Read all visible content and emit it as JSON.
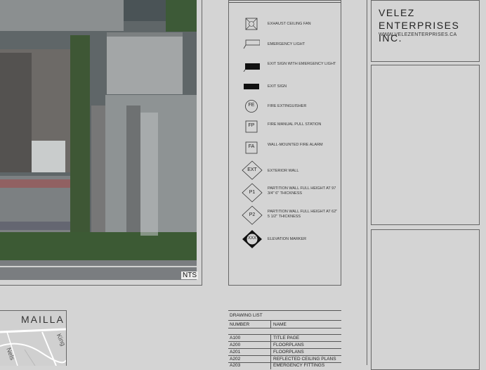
{
  "sheet": {
    "scale_note": "NTS"
  },
  "legend": {
    "items": [
      {
        "symbol": "exhaust-fan",
        "label": "EXHAUST CEILING FAN",
        "code": ""
      },
      {
        "symbol": "emergency-light",
        "label": "EMERGENCY LIGHT",
        "code": ""
      },
      {
        "symbol": "exit-emergency",
        "label": "EXIT SIGN WITH EMERGENCY LIGHT",
        "code": ""
      },
      {
        "symbol": "exit-sign",
        "label": "EXIT SIGN",
        "code": ""
      },
      {
        "symbol": "circle",
        "label": "FIRE EXTINGUISHER",
        "code": "FE"
      },
      {
        "symbol": "square",
        "label": "FIRE MANUAL PULL STATION",
        "code": "FP"
      },
      {
        "symbol": "square",
        "label": "WALL-MOUNTED FIRE ALARM",
        "code": "FA"
      },
      {
        "symbol": "diamond",
        "label": "EXTERIOR WALL",
        "code": "EXT"
      },
      {
        "symbol": "diamond",
        "label": "PARTITION WALL FULL HEIGHT AT 97 3/4\" 6\" THICKNESS",
        "code": "P1"
      },
      {
        "symbol": "diamond",
        "label": "PARTITION WALL FULL HEIGHT AT 62\" 5 1/2\" THICKNESS",
        "code": "P2"
      },
      {
        "symbol": "elevation",
        "label": "ELEVATION MARKER",
        "code": "XXX"
      }
    ]
  },
  "title_block": {
    "company_line1": "VELEZ",
    "company_line2": "ENTERPRISES INC.",
    "website": "WWW.VELEZENTERPRISES.CA"
  },
  "drawing_list": {
    "title": "DRAWING LIST",
    "col_number": "NUMBER",
    "col_name": "NAME",
    "rows": [
      {
        "number": "A100",
        "name": "TITLE PAGE"
      },
      {
        "number": "A200",
        "name": "FLOORPLANS"
      },
      {
        "number": "A201",
        "name": "FLOORPLANS"
      },
      {
        "number": "A202",
        "name": "REFLECTED CEILING PLANS"
      },
      {
        "number": "A203",
        "name": "EMERGENCY FITTINGS"
      }
    ]
  },
  "map": {
    "label_main": "MAILLA",
    "label_street1": "King",
    "label_street2": "Nels"
  }
}
